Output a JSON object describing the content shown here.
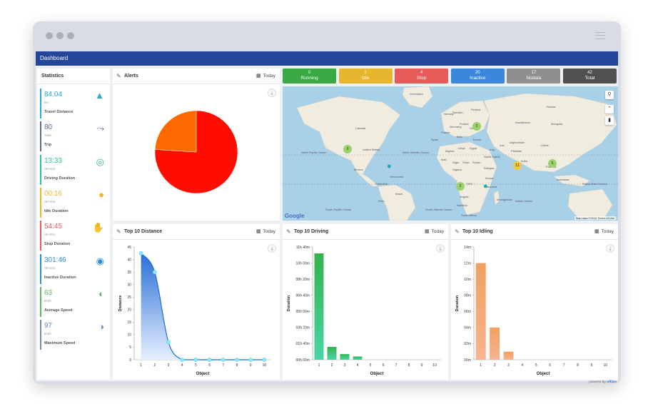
{
  "header": {
    "title": "Dashboard"
  },
  "statistics": {
    "title": "Statistics",
    "items": [
      {
        "value": "84.04",
        "unit": "km",
        "label": "Travel Distance",
        "color": "#2aa8e0",
        "icon": "road-icon"
      },
      {
        "value": "80",
        "unit": "Total",
        "label": "Trip",
        "color": "#5b6a9a",
        "icon": "route-icon"
      },
      {
        "value": "13:33",
        "unit": "HH:mm",
        "label": "Driving Duration",
        "color": "#2fbf9b",
        "icon": "steering-wheel-icon"
      },
      {
        "value": "00:16",
        "unit": "HH:mm",
        "label": "Idle Duration",
        "color": "#f0b429",
        "icon": "idle-icon"
      },
      {
        "value": "54:45",
        "unit": "HH:mm",
        "label": "Stop Duration",
        "color": "#e95b5b",
        "icon": "hand-stop-icon"
      },
      {
        "value": "301:46",
        "unit": "HH:mm",
        "label": "Inactive Duration",
        "color": "#2a8fd6",
        "icon": "signal-icon"
      },
      {
        "value": "63",
        "unit": "km/h",
        "label": "Average Speed",
        "color": "#5cb85c",
        "icon": "speedometer-icon"
      },
      {
        "value": "97",
        "unit": "km/h",
        "label": "Maximum Speed",
        "color": "#6b8fb5",
        "icon": "gauge-icon"
      }
    ]
  },
  "alerts": {
    "title": "Alerts",
    "today": "Today"
  },
  "status": [
    {
      "count": "0",
      "label": "Running",
      "color": "#3aa843"
    },
    {
      "count": "1",
      "label": "Idle",
      "color": "#e8b52f"
    },
    {
      "count": "4",
      "label": "Stop",
      "color": "#e85b5b"
    },
    {
      "count": "20",
      "label": "Inactive",
      "color": "#3d86de"
    },
    {
      "count": "17",
      "label": "Nodata",
      "color": "#8f8f8f"
    },
    {
      "count": "42",
      "label": "Total",
      "color": "#505050"
    }
  ],
  "map": {
    "clusters": [
      "3",
      "2",
      "11",
      "5",
      "2"
    ],
    "google": "Google",
    "attribution": "Map data ©2019   Terms of Use",
    "labels": [
      "Greenland",
      "Canada",
      "United States",
      "North Pacific Ocean",
      "North Atlantic Ocean",
      "Mexico",
      "Venezuela",
      "Colombia",
      "Brazil",
      "Peru",
      "South Pacific Ocean",
      "South Atlantic Ocean",
      "Libya",
      "Egypt",
      "Algeria",
      "Mali",
      "Niger",
      "Chad",
      "Sudan",
      "Nigeria",
      "Ethiopia",
      "DRC",
      "Kenya",
      "Tanzania",
      "Angola",
      "Namibia",
      "South Africa",
      "Madagascar",
      "Indian Ocean",
      "Saudi Arabia",
      "Iran",
      "Afghanistan",
      "Pakistan",
      "India",
      "China",
      "Kazakhstan",
      "Mongolia",
      "Russia",
      "Thailand",
      "Indonesia",
      "Papua New Guinea",
      "Sweden",
      "Finland",
      "Norway",
      "Germany",
      "Ukraine",
      "Poland",
      "France",
      "Spain",
      "Italy",
      "Turkey",
      "Iraq"
    ]
  },
  "distance_panel": {
    "title": "Top 10 Distance",
    "today": "Today"
  },
  "driving_panel": {
    "title": "Top 10 Driving",
    "today": "Today"
  },
  "idling_panel": {
    "title": "Top 10 Idling",
    "today": "Today"
  },
  "footer": {
    "powered": "powered By",
    "brand": "Uffizio"
  },
  "chart_data": [
    {
      "type": "pie",
      "title": "Alerts",
      "values": [
        76,
        24
      ],
      "colors": [
        "#ff0d00",
        "#ff6a00"
      ]
    },
    {
      "type": "area",
      "title": "Top 10 Distance",
      "xlabel": "Object",
      "ylabel": "Distance",
      "x": [
        1,
        2,
        3,
        4,
        5,
        6,
        7,
        8,
        9,
        10
      ],
      "values": [
        42.5,
        35,
        7,
        0,
        0,
        0,
        0,
        0,
        0,
        0
      ],
      "ylim": [
        0,
        45
      ],
      "yticks": [
        "0",
        "5",
        "10",
        "15",
        "20",
        "25",
        "30",
        "35",
        "40",
        "45"
      ],
      "color": "#1e6fd9"
    },
    {
      "type": "bar",
      "title": "Top 10 Driving",
      "xlabel": "Object",
      "ylabel": "Duration",
      "x": [
        1,
        2,
        3,
        4,
        5,
        6,
        7,
        8,
        9,
        10
      ],
      "values": [
        660,
        80,
        35,
        20,
        0,
        0,
        0,
        0,
        0,
        0
      ],
      "ylim": [
        0,
        700
      ],
      "yticks": [
        "00h 00m",
        "01h 40m",
        "03h 20m",
        "05h 00m",
        "06h 40m",
        "08h 20m",
        "10h 00m",
        "11h 40m"
      ],
      "color": "#3dc07a"
    },
    {
      "type": "bar",
      "title": "Top 10 Idling",
      "xlabel": "Object",
      "ylabel": "Duration",
      "x": [
        1,
        2,
        3,
        4,
        5,
        6,
        7,
        8,
        9,
        10
      ],
      "values": [
        12,
        4,
        1,
        0,
        0,
        0,
        0,
        0,
        0,
        0
      ],
      "ylim": [
        0,
        14
      ],
      "yticks": [
        "00m",
        "02m",
        "04m",
        "06m",
        "08m",
        "10m",
        "12m",
        "14m"
      ],
      "color": "#f5a46a"
    }
  ]
}
